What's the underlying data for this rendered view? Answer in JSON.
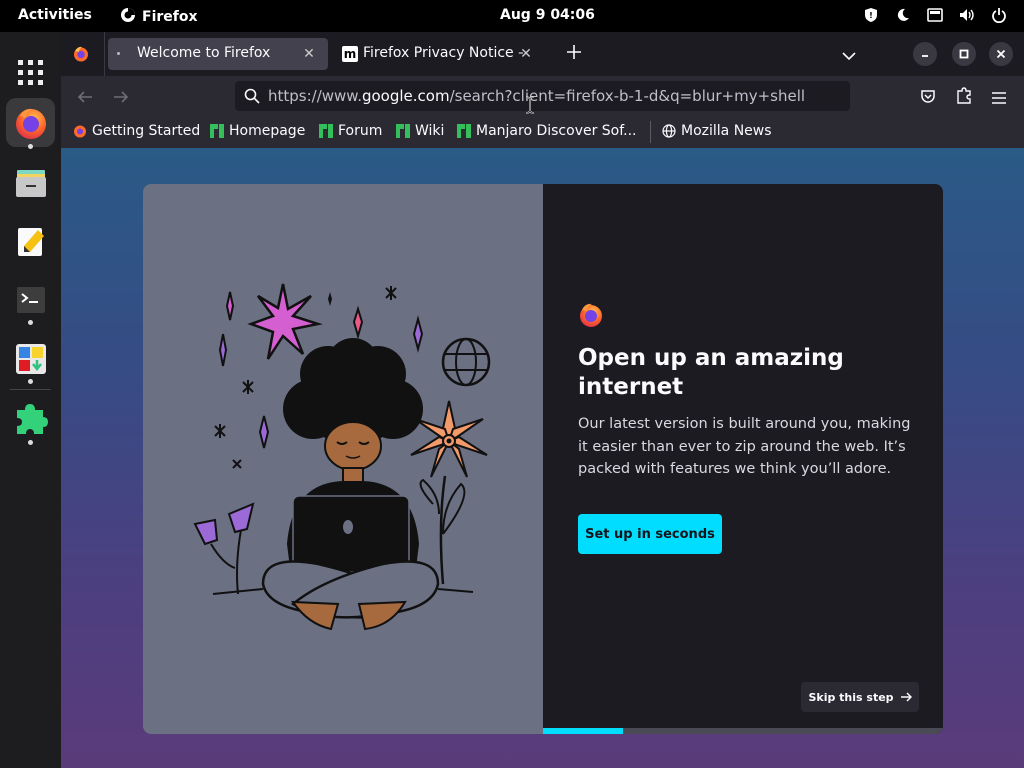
{
  "topbar": {
    "activities": "Activities",
    "app_name": "Firefox",
    "clock": "Aug 9  04:06"
  },
  "dock": {
    "items": [
      "firefox-icon",
      "files-icon",
      "text-editor-icon",
      "terminal-icon",
      "software-icon",
      "extensions-icon"
    ]
  },
  "tabs": [
    {
      "label": "Welcome to Firefox",
      "selected": true
    },
    {
      "label": "Firefox Privacy Notice —",
      "selected": false
    }
  ],
  "navbar": {
    "url_prefix": "https://www.",
    "url_domain": "google.com",
    "url_rest": "/search?client=firefox-b-1-d&q=blur+my+shell"
  },
  "bookmarks": [
    {
      "label": "Getting Started"
    },
    {
      "label": "Homepage"
    },
    {
      "label": "Forum"
    },
    {
      "label": "Wiki"
    },
    {
      "label": "Manjaro Discover Sof..."
    },
    {
      "label": "Mozilla News"
    }
  ],
  "onboarding": {
    "headline": "Open up an amazing internet",
    "body": "Our latest version is built around you, making it easier than ever to zip around the web. It’s packed with features we think you’ll adore.",
    "cta": "Set up in seconds",
    "skip": "Skip this step",
    "progress_fraction": 0.2
  },
  "colors": {
    "accent": "#00ddff",
    "chrome_dark": "#1c1b22",
    "toolbar": "#2b2a33",
    "illustration_bg": "#6b7083"
  }
}
